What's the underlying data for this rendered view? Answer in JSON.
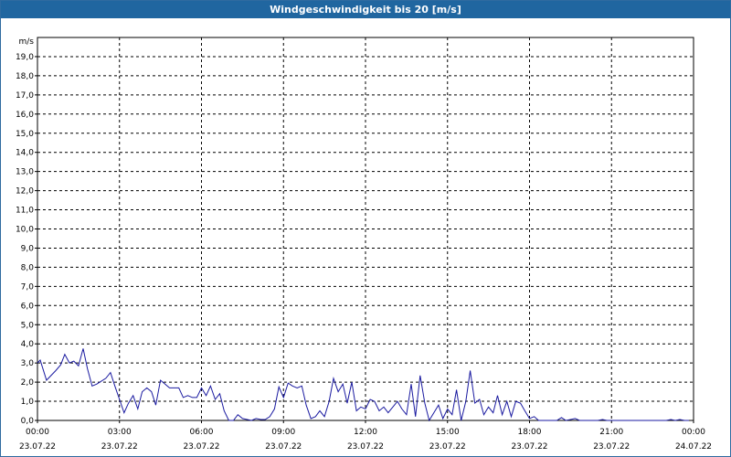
{
  "window": {
    "title": "Windgeschwindigkeit bis 20 [m/s]"
  },
  "colors": {
    "titlebar": "#2066a0",
    "series": "#1a1aa0",
    "grid": "#000000"
  },
  "chart_data": {
    "type": "line",
    "title": "Windgeschwindigkeit bis 20 [m/s]",
    "ylabel": "m/s",
    "xlabel": "",
    "ylim": [
      0,
      20
    ],
    "grid": true,
    "y_ticks": [
      "0,0",
      "1,0",
      "2,0",
      "3,0",
      "4,0",
      "5,0",
      "6,0",
      "7,0",
      "8,0",
      "9,0",
      "10,0",
      "11,0",
      "12,0",
      "13,0",
      "14,0",
      "15,0",
      "16,0",
      "17,0",
      "18,0",
      "19,0"
    ],
    "x_ticks": [
      {
        "time": "00:00",
        "date": "23.07.22"
      },
      {
        "time": "03:00",
        "date": "23.07.22"
      },
      {
        "time": "06:00",
        "date": "23.07.22"
      },
      {
        "time": "09:00",
        "date": "23.07.22"
      },
      {
        "time": "12:00",
        "date": "23.07.22"
      },
      {
        "time": "15:00",
        "date": "23.07.22"
      },
      {
        "time": "18:00",
        "date": "23.07.22"
      },
      {
        "time": "21:00",
        "date": "23.07.22"
      },
      {
        "time": "00:00",
        "date": "24.07.22"
      }
    ],
    "xlim_hours": [
      0,
      24
    ],
    "series": [
      {
        "x_hours": [
          0.0,
          0.1,
          0.33,
          0.67,
          0.85,
          1.0,
          1.17,
          1.33,
          1.5,
          1.67,
          1.83,
          2.0,
          2.17,
          2.5,
          2.67,
          2.83,
          3.0,
          3.17,
          3.33,
          3.5,
          3.67,
          3.83,
          4.0,
          4.17,
          4.33,
          4.5,
          4.67,
          4.83,
          5.0,
          5.17,
          5.33,
          5.5,
          5.67,
          5.83,
          6.0,
          6.17,
          6.33,
          6.5,
          6.67,
          6.83,
          7.0,
          7.17,
          7.33,
          7.5,
          7.67,
          7.83,
          8.0,
          8.17,
          8.33,
          8.5,
          8.67,
          8.83,
          9.0,
          9.17,
          9.33,
          9.5,
          9.67,
          9.83,
          10.0,
          10.17,
          10.33,
          10.5,
          10.67,
          10.83,
          11.0,
          11.17,
          11.33,
          11.5,
          11.67,
          11.83,
          12.0,
          12.17,
          12.33,
          12.5,
          12.67,
          12.83,
          13.0,
          13.17,
          13.33,
          13.5,
          13.67,
          13.83,
          14.0,
          14.17,
          14.33,
          14.5,
          14.67,
          14.83,
          15.0,
          15.17,
          15.33,
          15.5,
          15.67,
          15.83,
          16.0,
          16.17,
          16.33,
          16.5,
          16.67,
          16.83,
          17.0,
          17.17,
          17.33,
          17.5,
          17.67,
          17.83,
          18.0,
          18.17,
          18.33,
          18.5,
          18.67,
          18.83,
          19.0,
          19.17,
          19.33,
          19.5,
          19.67,
          19.83,
          20.0,
          20.17,
          20.33,
          20.5,
          20.67,
          20.83,
          21.0,
          21.17,
          21.33,
          21.5,
          21.67,
          21.83,
          22.0,
          22.17,
          22.33,
          22.5,
          22.67,
          22.83,
          23.0,
          23.17,
          23.33,
          23.5,
          23.67,
          23.83
        ],
        "values": [
          3.0,
          3.15,
          2.1,
          2.6,
          2.9,
          3.45,
          3.0,
          3.1,
          2.85,
          3.75,
          2.7,
          1.8,
          1.9,
          2.2,
          2.5,
          1.8,
          1.1,
          0.4,
          0.9,
          1.3,
          0.6,
          1.5,
          1.7,
          1.5,
          0.8,
          2.1,
          1.9,
          1.7,
          1.7,
          1.7,
          1.2,
          1.3,
          1.2,
          1.2,
          1.7,
          1.3,
          1.8,
          1.1,
          1.4,
          0.5,
          0.0,
          0.0,
          0.3,
          0.1,
          0.05,
          0.0,
          0.1,
          0.05,
          0.05,
          0.2,
          0.6,
          1.75,
          1.2,
          1.95,
          1.8,
          1.7,
          1.8,
          0.8,
          0.1,
          0.2,
          0.5,
          0.2,
          1.0,
          2.2,
          1.5,
          1.9,
          0.9,
          2.0,
          0.5,
          0.7,
          0.6,
          1.1,
          1.0,
          0.5,
          0.7,
          0.4,
          0.7,
          1.0,
          0.6,
          0.3,
          1.9,
          0.2,
          2.35,
          0.9,
          0.0,
          0.4,
          0.8,
          0.1,
          0.6,
          0.3,
          1.6,
          0.0,
          1.0,
          2.6,
          0.9,
          1.1,
          0.3,
          0.7,
          0.4,
          1.3,
          0.3,
          1.0,
          0.2,
          1.0,
          0.9,
          0.5,
          0.1,
          0.2,
          0.0,
          0.0,
          0.0,
          0.0,
          0.0,
          0.15,
          0.0,
          0.05,
          0.1,
          0.0,
          0.0,
          0.0,
          0.0,
          0.0,
          0.05,
          0.0,
          0.0,
          0.0,
          0.0,
          0.0,
          0.0,
          0.0,
          0.0,
          0.0,
          0.0,
          0.0,
          0.0,
          0.0,
          0.0,
          0.05,
          0.0,
          0.05,
          0.0,
          0.0,
          0.0
        ]
      }
    ]
  }
}
